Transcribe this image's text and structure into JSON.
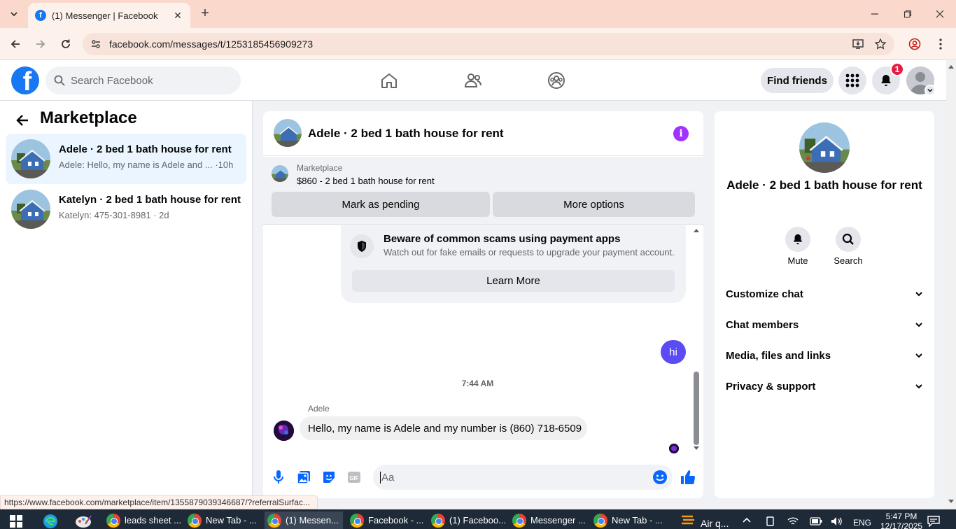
{
  "browser": {
    "tab_title": "(1) Messenger | Facebook",
    "url": "facebook.com/messages/t/1253185456909273",
    "status_url": "https://www.facebook.com/marketplace/item/1355879039346687/?referralSurfac..."
  },
  "header": {
    "search_placeholder": "Search Facebook",
    "find_friends": "Find friends",
    "notification_count": "1"
  },
  "sidebar": {
    "title": "Marketplace",
    "threads": [
      {
        "name": "Adele · 2 bed 1 bath house for rent",
        "snippet": "Adele: Hello, my name is Adele and ...",
        "time": "·10h",
        "selected": true
      },
      {
        "name": "Katelyn · 2 bed 1 bath house for rent",
        "snippet": "Katelyn: 475-301-8981 · 2d",
        "time": "",
        "selected": false
      }
    ]
  },
  "chat": {
    "title": "Adele · 2 bed 1 bath house for rent",
    "listing_kicker": "Marketplace",
    "listing_title": "$860 - 2 bed 1 bath house for rent",
    "mark_pending": "Mark as pending",
    "more_options": "More options",
    "scam_title": "Beware of common scams using payment apps",
    "scam_sub": "Watch out for fake emails or requests to upgrade your payment account.",
    "learn_more": "Learn More",
    "my_message": "hi",
    "timestamp": "7:44 AM",
    "sender": "Adele",
    "their_message": "Hello, my name is Adele and my number is (860) 718-6509",
    "input_placeholder": "Aa"
  },
  "details": {
    "title": "Adele · 2 bed 1 bath house for rent",
    "actions": [
      {
        "label": "Mute",
        "icon": "bell-icon"
      },
      {
        "label": "Search",
        "icon": "search-icon"
      }
    ],
    "sections": [
      "Customize chat",
      "Chat members",
      "Media, files and links",
      "Privacy & support"
    ]
  },
  "taskbar": {
    "items": [
      {
        "label": "leads sheet ..."
      },
      {
        "label": "New Tab - ..."
      },
      {
        "label": "(1) Messen..."
      },
      {
        "label": "Facebook - ..."
      },
      {
        "label": "(1) Faceboo..."
      },
      {
        "label": "Messenger ..."
      },
      {
        "label": "New Tab - ..."
      }
    ],
    "weather": "Air q...",
    "lang": "ENG",
    "time": "5:47 PM",
    "date": "12/17/2025"
  },
  "colors": {
    "brand": "#1877f2",
    "accent": "#5b4bf5",
    "info": "#a033ff"
  }
}
